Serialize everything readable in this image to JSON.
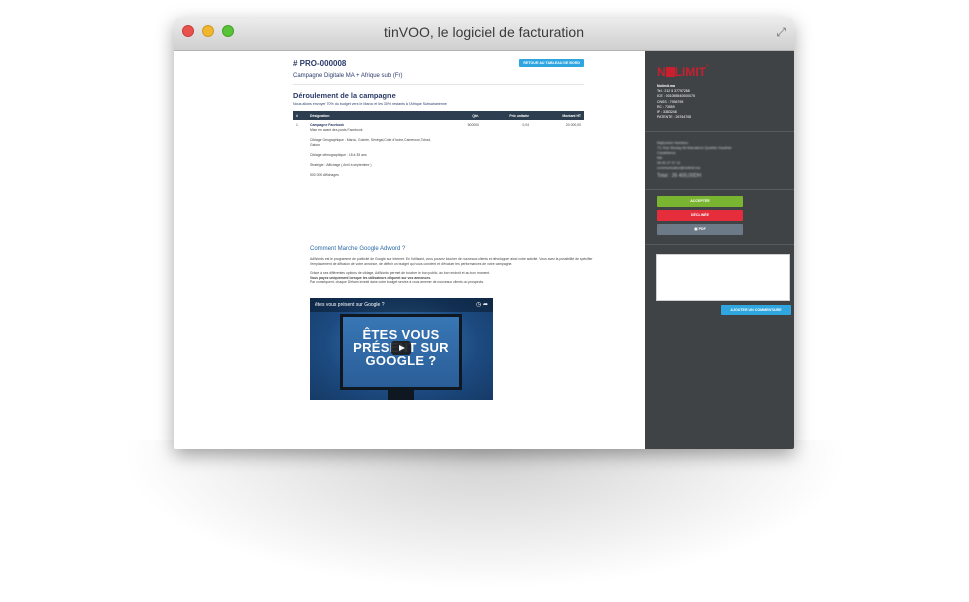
{
  "window": {
    "title": "tinVOO, le logiciel de facturation",
    "expand_icon": "expand-arrows-icon"
  },
  "proposal": {
    "number": "# PRO-000008",
    "back_button": "RETOUR AU TABLEAU DE BORD",
    "campaign": "Campagne Digitale MA + Afrique sub (Fr)",
    "section_title": "Déroulement de la campagne",
    "section_sub": "Nous allons envoyer 70% du budget vers le Maroc et les 30% restants à l'Afrique Subsaharienne"
  },
  "table": {
    "headers": [
      "#",
      "Désignation",
      "Qté.",
      "Prix unitaire",
      "Montant HT"
    ],
    "row": {
      "index": "1",
      "title": "Campagne Facebook",
      "lines": [
        "Mise en avant des posts Facebook",
        "",
        "Ciblage Géographique : Maroc, Guinée, Sénégal,Cote d'Ivoire,Cameroun,Tchad, Gabon",
        "",
        "Ciblage démographique : 18 à 35 ans",
        "",
        "Stratégie : Affichage ( Avril à septembre )",
        "",
        "500 000 Affichages"
      ],
      "qty": "500000",
      "unit_price": "0,04",
      "amount": "20 000,00"
    }
  },
  "article": {
    "title": "Comment Marche Google Adword ?",
    "p1": "AdWords est le programme de publicité de Google sur Internet. En l'utilisant, vous pouvez toucher de nouveaux clients et développer ainsi votre activité. Vous avez la possibilité de spécifier l'emplacement de diffusion de votre annonce, de définir un budget qui vous convient et d'évaluer les performances de votre campagne.",
    "p2a": "Grâce à ses différentes options de ciblage, AdWords permet de toucher le bon public, au bon endroit et au bon moment.",
    "p2b": "Vous payez uniquement lorsque les utilisateurs cliquent sur vos annonces.",
    "p2c": "Par conséquent, chaque Dirham investi dans votre budget servira à vous amener de nouveaux clients ou prospects."
  },
  "video": {
    "title": "êtes vous présent sur Google ?",
    "screen_text": "ÊTES VOUS PRÉSENT SUR GOOGLE ?"
  },
  "sidebar": {
    "logo_left": "N",
    "logo_right": "LIMIT",
    "logo_reg": "®",
    "company_name": "Nolimit.ma",
    "company_lines": [
      "Tel : 212 5 37797288",
      "ICE : 001055540000075",
      "CNSS : 7936795",
      "RC : 73559",
      "IF : 3383248",
      "PATENTE : 26764708"
    ],
    "client_lines": [
      "Majhoulne Hamidou",
      "73, Rue Moulay Ali Marrakech Quartier Gauthier",
      "Casablanca",
      "MA",
      "06 00 27 07 12",
      "communication@nolimit.ma"
    ],
    "total": "Total : 26 400,00DH",
    "accept": "ACCEPTÉE",
    "decline": "DÉCLINÉE",
    "pdf": "PDF",
    "add_comment": "AJOUTER UN COMMENTAIRE"
  }
}
